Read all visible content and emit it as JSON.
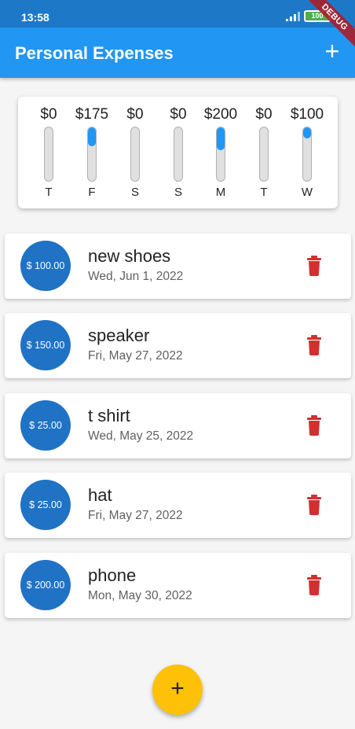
{
  "status_bar": {
    "time": "13:58",
    "battery": "100",
    "debug_label": "DEBUG"
  },
  "app_bar": {
    "title": "Personal Expenses",
    "add_icon": "+"
  },
  "chart": {
    "bars": [
      {
        "day": "T",
        "amount": "$0",
        "fraction": 0.0
      },
      {
        "day": "F",
        "amount": "$175",
        "fraction": 0.36
      },
      {
        "day": "S",
        "amount": "$0",
        "fraction": 0.0
      },
      {
        "day": "S",
        "amount": "$0",
        "fraction": 0.0
      },
      {
        "day": "M",
        "amount": "$200",
        "fraction": 0.42
      },
      {
        "day": "T",
        "amount": "$0",
        "fraction": 0.0
      },
      {
        "day": "W",
        "amount": "$100",
        "fraction": 0.21
      }
    ]
  },
  "transactions": [
    {
      "amount": "$ 100.00",
      "title": "new shoes",
      "date": "Wed, Jun 1, 2022"
    },
    {
      "amount": "$ 150.00",
      "title": "speaker",
      "date": "Fri, May 27, 2022"
    },
    {
      "amount": "$ 25.00",
      "title": "t shirt",
      "date": "Wed, May 25, 2022"
    },
    {
      "amount": "$ 25.00",
      "title": "hat",
      "date": "Fri, May 27, 2022"
    },
    {
      "amount": "$ 200.00",
      "title": "phone",
      "date": "Mon, May 30, 2022"
    }
  ],
  "fab": {
    "icon": "+"
  },
  "colors": {
    "app_bar": "#2196f3",
    "status_bar": "#1e78c8",
    "avatar": "#1f72c4",
    "delete": "#d32f2f",
    "fab": "#ffc107"
  },
  "icons": {
    "delete": "trash-icon",
    "signal": "signal-icon",
    "battery": "battery-icon"
  }
}
